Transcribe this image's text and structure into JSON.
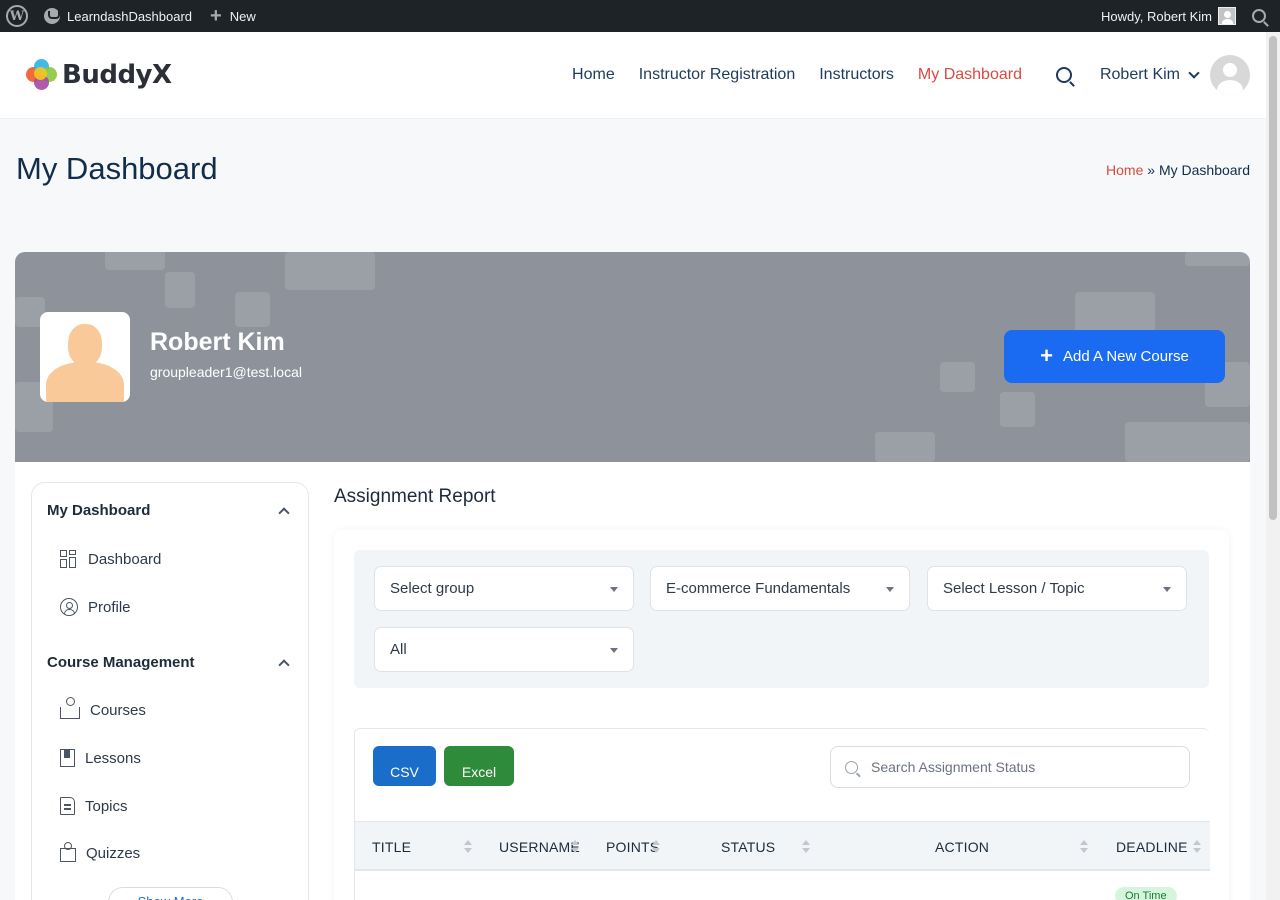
{
  "adminbar": {
    "site_name": "LearndashDashboard",
    "new_label": "New",
    "greeting": "Howdy, Robert Kim"
  },
  "header": {
    "logo_text": "BuddyX",
    "nav": [
      {
        "label": "Home"
      },
      {
        "label": "Instructor Registration"
      },
      {
        "label": "Instructors"
      },
      {
        "label": "My Dashboard",
        "active": true
      }
    ],
    "user_name": "Robert Kim"
  },
  "page": {
    "title": "My Dashboard",
    "breadcrumb_home": "Home",
    "breadcrumb_sep": "»",
    "breadcrumb_current": "My Dashboard"
  },
  "profile": {
    "name": "Robert Kim",
    "email": "groupleader1@test.local",
    "add_course_label": "Add A New Course"
  },
  "sidebar": {
    "section1": "My Dashboard",
    "section1_items": [
      {
        "label": "Dashboard",
        "icon": "dashboard-grid-icon"
      },
      {
        "label": "Profile",
        "icon": "user-circle-icon"
      }
    ],
    "section2": "Course Management",
    "section2_items": [
      {
        "label": "Courses",
        "icon": "course-book-icon"
      },
      {
        "label": "Lessons",
        "icon": "bookmark-icon"
      },
      {
        "label": "Topics",
        "icon": "document-icon"
      },
      {
        "label": "Quizzes",
        "icon": "puzzle-icon"
      }
    ],
    "show_more": "Show More"
  },
  "report": {
    "title": "Assignment Report",
    "filters": {
      "group": "Select group",
      "course": "E-commerce Fundamentals",
      "lesson": "Select Lesson / Topic",
      "status": "All"
    },
    "csv_label": "CSV",
    "excel_label": "Excel",
    "search_placeholder": "Search Assignment Status",
    "columns": [
      "TITLE",
      "USERNAME",
      "POINTS",
      "STATUS",
      "ACTION",
      "DEADLINE"
    ],
    "first_row_deadline": "On Time"
  },
  "colors": {
    "accent": "#1a6bf2",
    "nav_active": "#d94a41",
    "csv": "#1a6dc8",
    "excel": "#2e8b3a"
  }
}
